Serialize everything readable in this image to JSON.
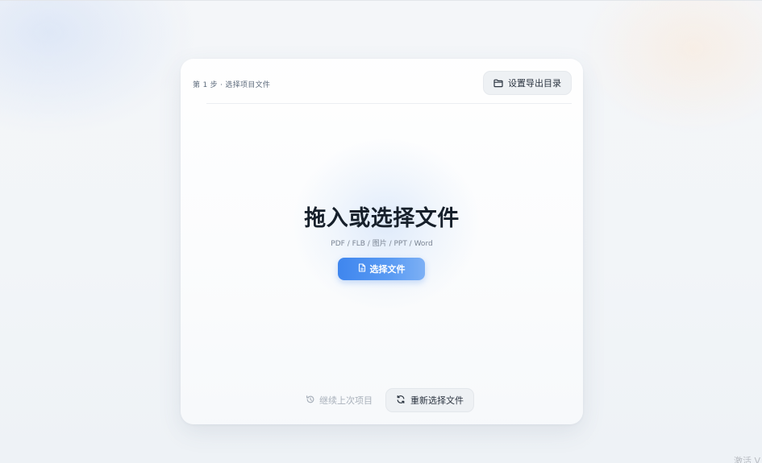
{
  "card": {
    "step_label": "第 1 步 · 选择项目文件",
    "export_dir_button": "设置导出目录",
    "title": "拖入或选择文件",
    "formats": "PDF / FLB / 图片 / PPT / Word",
    "choose_button": "选择文件",
    "continue_button": "继续上次项目",
    "reselect_button": "重新选择文件"
  },
  "watermark": "激活 V",
  "icons": {
    "export_dir": "folder-icon",
    "choose": "file-icon",
    "continue": "history-icon",
    "reselect": "refresh-icon"
  },
  "colors": {
    "accent": "#3f86ee",
    "title": "#17202b",
    "muted": "#7b8593",
    "disabled": "#a9b1bb"
  }
}
